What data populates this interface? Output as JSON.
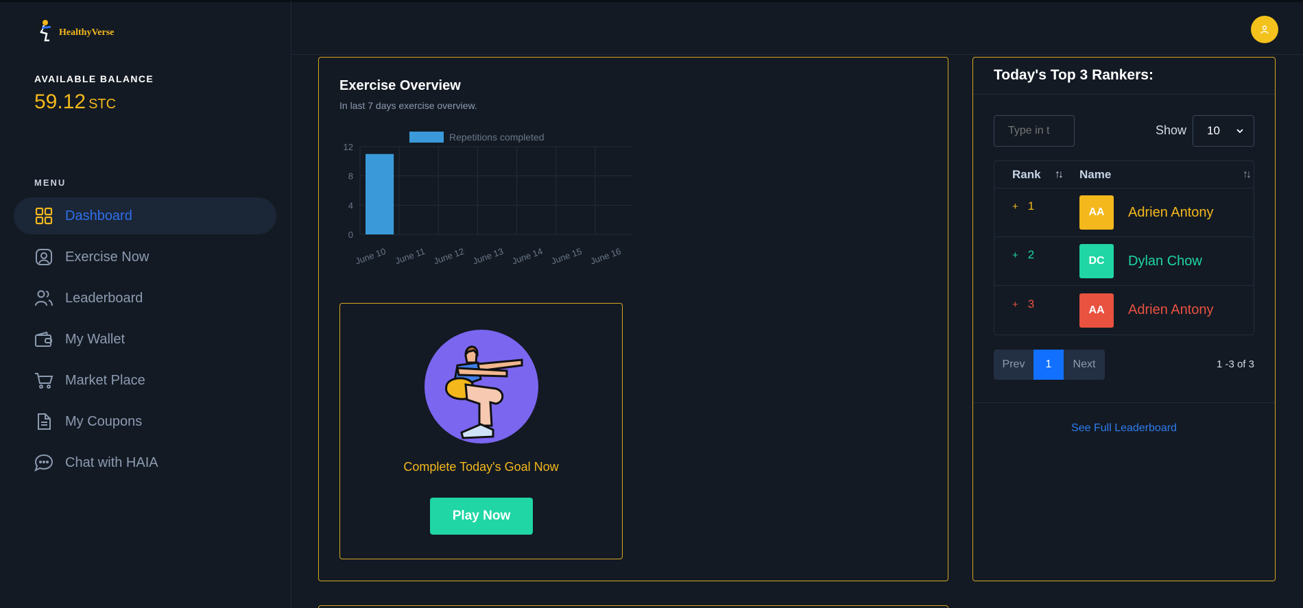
{
  "brand": {
    "name": "HealthyVerse"
  },
  "balance": {
    "label": "AVAILABLE BALANCE",
    "value": "59.12",
    "unit": "STC"
  },
  "menu": {
    "label": "MENU",
    "items": [
      {
        "label": "Dashboard",
        "icon": "grid-icon",
        "active": true
      },
      {
        "label": "Exercise Now",
        "icon": "user-square-icon"
      },
      {
        "label": "Leaderboard",
        "icon": "users-icon"
      },
      {
        "label": "My Wallet",
        "icon": "wallet-icon"
      },
      {
        "label": "Market Place",
        "icon": "cart-icon"
      },
      {
        "label": "My Coupons",
        "icon": "document-icon"
      },
      {
        "label": "Chat with HAIA",
        "icon": "chat-icon"
      }
    ]
  },
  "header": {
    "avatar_icon": "user-icon"
  },
  "exercise": {
    "title": "Exercise Overview",
    "subtitle": "In last 7 days exercise overview.",
    "goal_text": "Complete Today's Goal Now",
    "play_label": "Play Now"
  },
  "chart_data": {
    "type": "bar",
    "series": [
      {
        "name": "Repetitions completed",
        "values": [
          11,
          0,
          0,
          0,
          0,
          0,
          0
        ]
      }
    ],
    "categories": [
      "June 10",
      "June 11",
      "June 12",
      "June 13",
      "June 14",
      "June 15",
      "June 16"
    ],
    "yticks": [
      0,
      4,
      8,
      12
    ],
    "ylim": [
      0,
      12
    ],
    "grid": true,
    "legend": "top",
    "colors": {
      "bar": "#3a9ad9",
      "tick": "#6b7789",
      "grid": "#232c38"
    }
  },
  "rankers": {
    "title": "Today's Top 3 Rankers:",
    "search_placeholder": "Type in t",
    "show_label": "Show",
    "show_value": "10",
    "columns": {
      "rank": "Rank",
      "name": "Name"
    },
    "rows": [
      {
        "plus": "+",
        "rank": "1",
        "initials": "AA",
        "name": "Adrien Antony",
        "color": "#f4b81c",
        "badge": "#f4b81c"
      },
      {
        "plus": "+",
        "rank": "2",
        "initials": "DC",
        "name": "Dylan Chow",
        "color": "#1fd6a4",
        "badge": "#1fd6a4"
      },
      {
        "plus": "+",
        "rank": "3",
        "initials": "AA",
        "name": "Adrien Antony",
        "color": "#e8523f",
        "badge": "#e8523f"
      }
    ],
    "pager": {
      "prev": "Prev",
      "current": "1",
      "next": "Next"
    },
    "page_info": "1 -3 of 3",
    "full_link": "See Full Leaderboard"
  }
}
